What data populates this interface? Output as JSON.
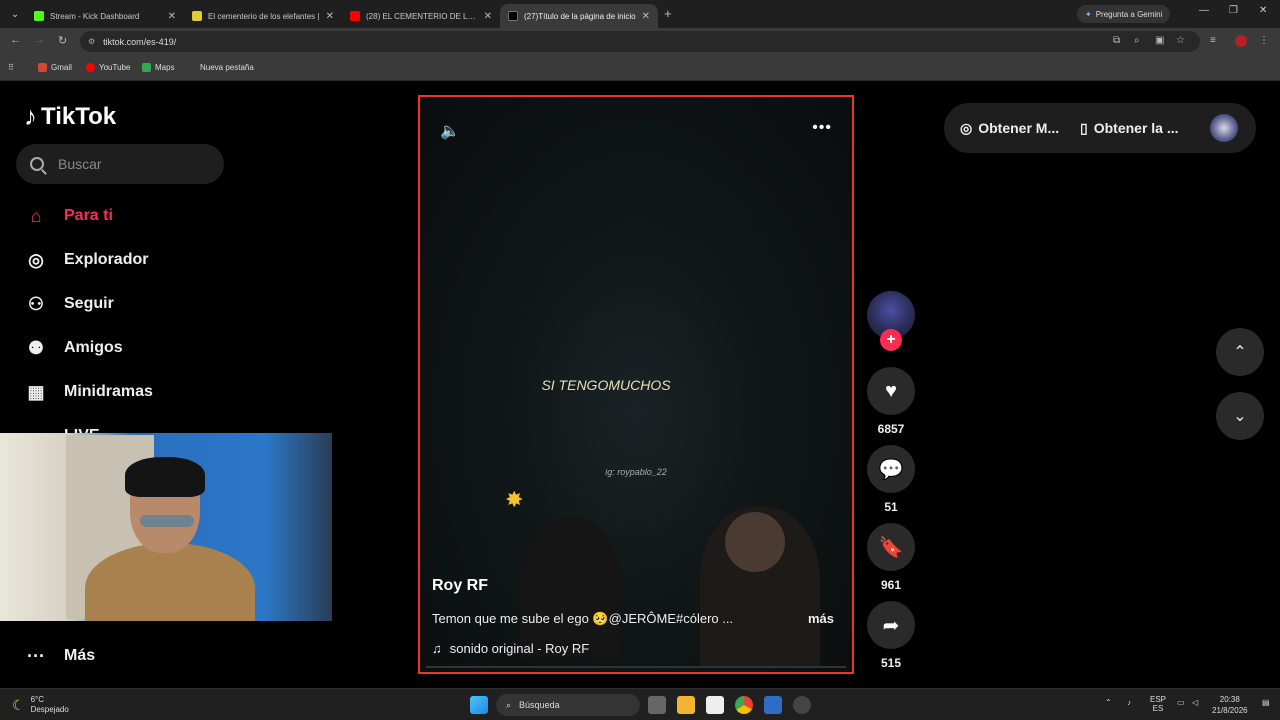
{
  "browser": {
    "tabs": [
      {
        "title": "Stream - Kick Dashboard",
        "color": "#53fc18",
        "active": false
      },
      {
        "title": "El cementerio de los elefantes |",
        "color": "#e0cc33",
        "active": false
      },
      {
        "title": "(28) EL CEMENTERIO DE LOS EL...",
        "color": "#ff0000",
        "active": false
      },
      {
        "title": "(27)Título de la página de inicio",
        "color": "#000000",
        "active": true
      }
    ],
    "gemini_label": "Pregunta a Gemini",
    "url": "tiktok.com/es-419/",
    "bookmarks": [
      {
        "label": "Gmail",
        "color": "#d44638"
      },
      {
        "label": "YouTube",
        "color": "#ff0000"
      },
      {
        "label": "Maps",
        "color": "#34a853"
      },
      {
        "label": "Nueva pestaña",
        "color": ""
      }
    ]
  },
  "tiktok": {
    "logo": "TikTok",
    "search_placeholder": "Buscar",
    "menu": [
      {
        "label": "Para ti",
        "icon": "home-icon",
        "active": true
      },
      {
        "label": "Explorador",
        "icon": "compass-icon",
        "active": false
      },
      {
        "label": "Seguir",
        "icon": "follow-icon",
        "active": false
      },
      {
        "label": "Amigos",
        "icon": "friends-icon",
        "active": false
      },
      {
        "label": "Minidramas",
        "icon": "film-icon",
        "active": false
      },
      {
        "label": "LIVE",
        "icon": "live-icon",
        "active": false
      },
      {
        "label": "Más",
        "icon": "more-icon",
        "active": false
      }
    ],
    "get_app": {
      "left": "Obtener M...",
      "right": "Obtener la ..."
    },
    "video": {
      "lyric": "SI TENGOMUCHOS",
      "watermark": "ig: roypablo_22",
      "author": "Roy RF",
      "description": "Temon que me sube el ego 🥺@JERÔME#cólero ...",
      "more": "más",
      "sound": "sonido original - Roy RF"
    },
    "actions": {
      "likes": "6857",
      "comments": "51",
      "saves": "961",
      "shares": "515"
    }
  },
  "taskbar": {
    "weather_temp": "6°C",
    "weather_desc": "Despejado",
    "search_label": "Búsqueda",
    "lang_top": "ESP",
    "lang_bottom": "ES",
    "time": "20:38",
    "date": "21/8/2026"
  }
}
